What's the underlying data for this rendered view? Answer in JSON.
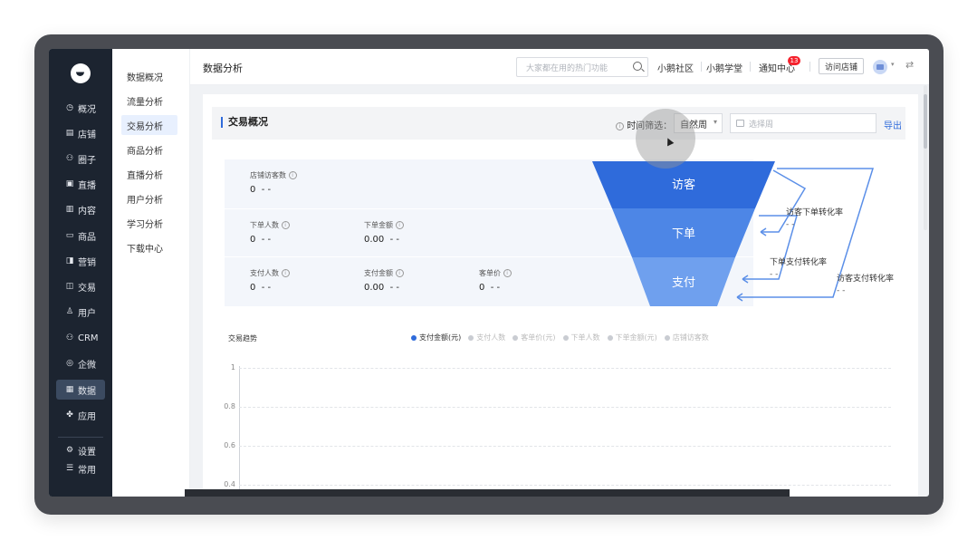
{
  "sidebar": {
    "items": [
      {
        "label": "概况",
        "icon": "clock-icon",
        "glyph": "◷"
      },
      {
        "label": "店铺",
        "icon": "store-icon",
        "glyph": "▤"
      },
      {
        "label": "圈子",
        "icon": "group-icon",
        "glyph": "⚇"
      },
      {
        "label": "直播",
        "icon": "live-icon",
        "glyph": "▣"
      },
      {
        "label": "内容",
        "icon": "document-icon",
        "glyph": "▥"
      },
      {
        "label": "商品",
        "icon": "goods-icon",
        "glyph": "▭"
      },
      {
        "label": "营销",
        "icon": "megaphone-icon",
        "glyph": "◨"
      },
      {
        "label": "交易",
        "icon": "trade-icon",
        "glyph": "◫"
      },
      {
        "label": "用户",
        "icon": "user-icon",
        "glyph": "♙"
      },
      {
        "label": "CRM",
        "icon": "crm-icon",
        "glyph": "⚇"
      },
      {
        "label": "企微",
        "icon": "wecom-icon",
        "glyph": "◎"
      },
      {
        "label": "数据",
        "icon": "data-icon",
        "glyph": "▦"
      },
      {
        "label": "应用",
        "icon": "apps-icon",
        "glyph": "✤"
      }
    ],
    "bottom": [
      {
        "label": "设置",
        "icon": "gear-icon",
        "glyph": "⚙"
      },
      {
        "label": "常用",
        "icon": "list-icon",
        "glyph": "☰"
      }
    ]
  },
  "submenu": {
    "items": [
      "数据概况",
      "流量分析",
      "交易分析",
      "商品分析",
      "直播分析",
      "用户分析",
      "学习分析",
      "下载中心"
    ]
  },
  "header": {
    "title": "数据分析",
    "search_placeholder": "大家都在用的热门功能",
    "community": "小鹅社区",
    "academy": "小鹅学堂",
    "notifications": "通知中心",
    "notification_count": "13",
    "visit_store": "访问店铺"
  },
  "overview": {
    "title": "交易概况",
    "filter_label": "时间筛选：",
    "period": "自然周",
    "date_placeholder": "选择周",
    "export": "导出"
  },
  "metrics": {
    "store_visitors": {
      "label": "店铺访客数",
      "value": "0",
      "trend": "- -"
    },
    "order_users": {
      "label": "下单人数",
      "value": "0",
      "trend": "- -"
    },
    "order_amount": {
      "label": "下单金额",
      "value": "0.00",
      "trend": "- -"
    },
    "pay_users": {
      "label": "支付人数",
      "value": "0",
      "trend": "- -"
    },
    "pay_amount": {
      "label": "支付金额",
      "value": "0.00",
      "trend": "- -"
    },
    "avg_price": {
      "label": "客单价",
      "value": "0",
      "trend": "- -"
    }
  },
  "funnel": {
    "stages": [
      "访客",
      "下单",
      "支付"
    ],
    "colors": [
      "#2f6bdb",
      "#4d86e6",
      "#6fa0ee"
    ],
    "rates": [
      {
        "label": "访客下单转化率",
        "value": "- -"
      },
      {
        "label": "下单支付转化率",
        "value": "- -"
      },
      {
        "label": "访客支付转化率",
        "value": "- -"
      }
    ]
  },
  "trend": {
    "title": "交易趋势",
    "legend": [
      "支付金额(元)",
      "支付人数",
      "客单价(元)",
      "下单人数",
      "下单金额(元)",
      "店铺访客数"
    ],
    "active_series": "支付金额(元)",
    "yticks": [
      "1",
      "0.8",
      "0.6",
      "0.4"
    ]
  }
}
